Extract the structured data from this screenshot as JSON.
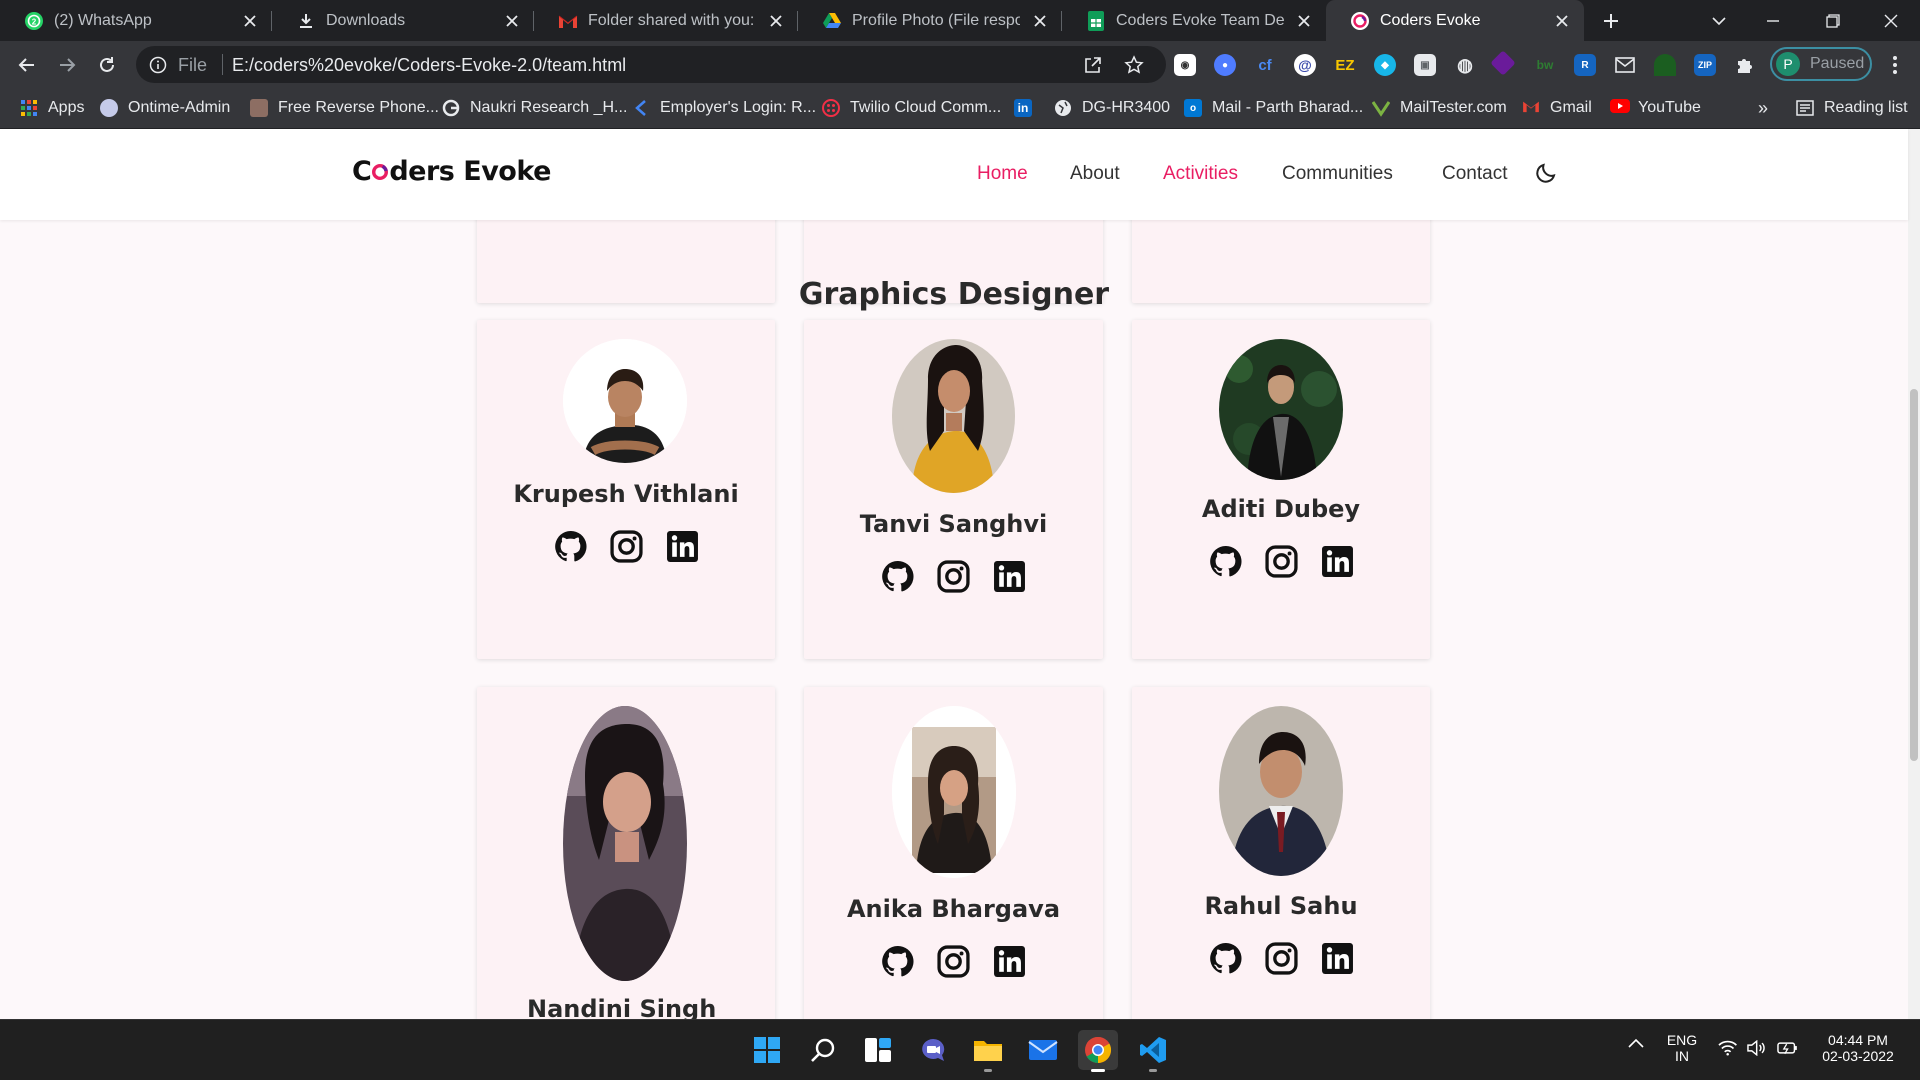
{
  "browser": {
    "tabs": [
      {
        "title": "(2) WhatsApp",
        "icon": "whatsapp-icon",
        "active": false
      },
      {
        "title": "Downloads",
        "icon": "download-icon",
        "active": false
      },
      {
        "title": "Folder shared with you: 'Pro",
        "icon": "gmail-icon",
        "active": false
      },
      {
        "title": "Profile Photo (File response",
        "icon": "google-drive-icon",
        "active": false
      },
      {
        "title": "Coders Evoke Team Details",
        "icon": "google-sheets-icon",
        "active": false
      },
      {
        "title": "Coders Evoke",
        "icon": "site-icon",
        "active": true
      }
    ],
    "address": {
      "scheme": "File",
      "url": "E:/coders%20evoke/Coders-Evoke-2.0/team.html"
    },
    "profile": {
      "initial": "P",
      "status": "Paused"
    },
    "bookmarks": [
      {
        "label": "Apps",
        "icon": "apps-grid-icon"
      },
      {
        "label": "Ontime-Admin",
        "icon": "ontime-icon"
      },
      {
        "label": "Free Reverse Phone...",
        "icon": "phone-lookup-icon"
      },
      {
        "label": "Naukri Research _H...",
        "icon": "google-icon"
      },
      {
        "label": "Employer's Login: R...",
        "icon": "employer-icon"
      },
      {
        "label": "Twilio Cloud Comm...",
        "icon": "twilio-icon"
      },
      {
        "label": "",
        "icon": "linkedin-icon"
      },
      {
        "label": "DG-HR3400",
        "icon": "globe-icon"
      },
      {
        "label": "Mail - Parth Bharad...",
        "icon": "outlook-icon"
      },
      {
        "label": "MailTester.com",
        "icon": "mailtester-icon"
      },
      {
        "label": "Gmail",
        "icon": "gmail-icon"
      },
      {
        "label": "YouTube",
        "icon": "youtube-icon"
      }
    ],
    "more_bookmarks": "»",
    "reading_list": "Reading list"
  },
  "site": {
    "brand": {
      "before": "C",
      "o": "o",
      "after": "ders Evoke"
    },
    "nav": [
      {
        "label": "Home",
        "highlight": true
      },
      {
        "label": "About",
        "highlight": false
      },
      {
        "label": "Activities",
        "highlight": true
      },
      {
        "label": "Communities",
        "highlight": false
      },
      {
        "label": "Contact",
        "highlight": false
      }
    ],
    "accent_color": "#e91e63",
    "section_title": "Graphics Designer",
    "members": [
      {
        "name": "Krupesh Vithlani",
        "photo": "avatar-krupesh"
      },
      {
        "name": "Tanvi Sanghvi",
        "photo": "avatar-tanvi"
      },
      {
        "name": "Aditi Dubey",
        "photo": "avatar-aditi"
      },
      {
        "name": "Nandini Singh",
        "photo": "avatar-nandini"
      },
      {
        "name": "Anika Bhargava",
        "photo": "avatar-anika"
      },
      {
        "name": "Rahul Sahu",
        "photo": "avatar-rahul"
      }
    ]
  },
  "taskbar": {
    "language": "ENG",
    "region": "IN",
    "time": "04:44 PM",
    "date": "02-03-2022"
  }
}
